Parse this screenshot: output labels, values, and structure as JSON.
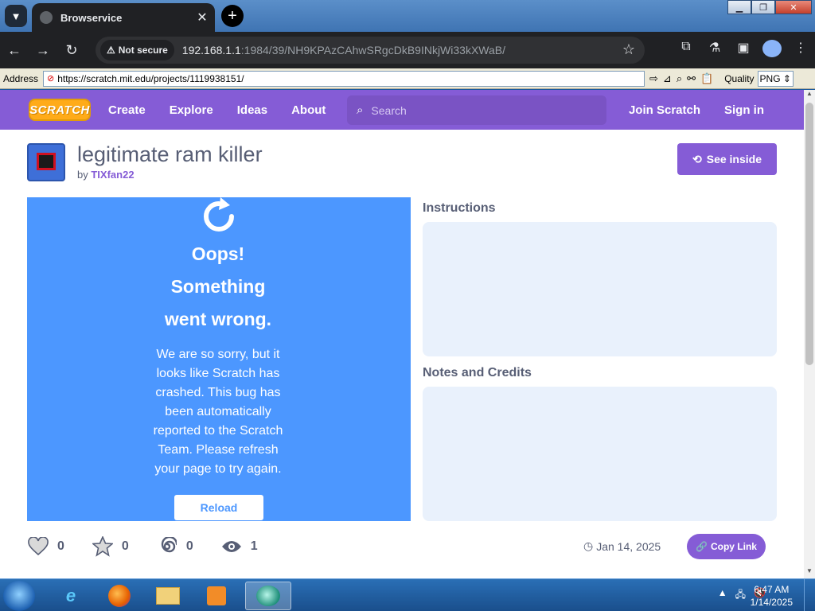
{
  "browser": {
    "tab_title": "Browservice",
    "tab_close": "✕",
    "new_tab": "+",
    "security_label": "Not secure",
    "url_host": "192.168.1.1",
    "url_rest": ":1984/39/NH9KPAzCAhwSRgcDkB9INkjWi33kXWaB/"
  },
  "addressbar": {
    "label": "Address",
    "url": "https://scratch.mit.edu/projects/1119938151/",
    "quality_label": "Quality",
    "format_value": "PNG"
  },
  "scratch": {
    "logo_text": "SCRATCH",
    "nav": {
      "create": "Create",
      "explore": "Explore",
      "ideas": "Ideas",
      "about": "About",
      "search_placeholder": "Search",
      "join": "Join Scratch",
      "signin": "Sign in"
    },
    "project": {
      "title": "legitimate ram killer",
      "by_label": "by",
      "author": "TIXfan22",
      "see_inside": "See inside"
    },
    "stage": {
      "oops_line1": "Oops!",
      "oops_line2": "Something",
      "oops_line3": "went wrong.",
      "message": "We are so sorry, but it looks like Scratch has crashed. This bug has been automatically reported to the Scratch Team. Please refresh your page to try again.",
      "reload_button": "Reload"
    },
    "instructions_title": "Instructions",
    "notes_title": "Notes and Credits",
    "stats": {
      "loves": "0",
      "favorites": "0",
      "remixes": "0",
      "views": "1"
    },
    "date": "Jan 14, 2025",
    "copy_link": "Copy Link"
  },
  "taskbar": {
    "time": "6:47 AM",
    "date": "1/14/2025"
  }
}
